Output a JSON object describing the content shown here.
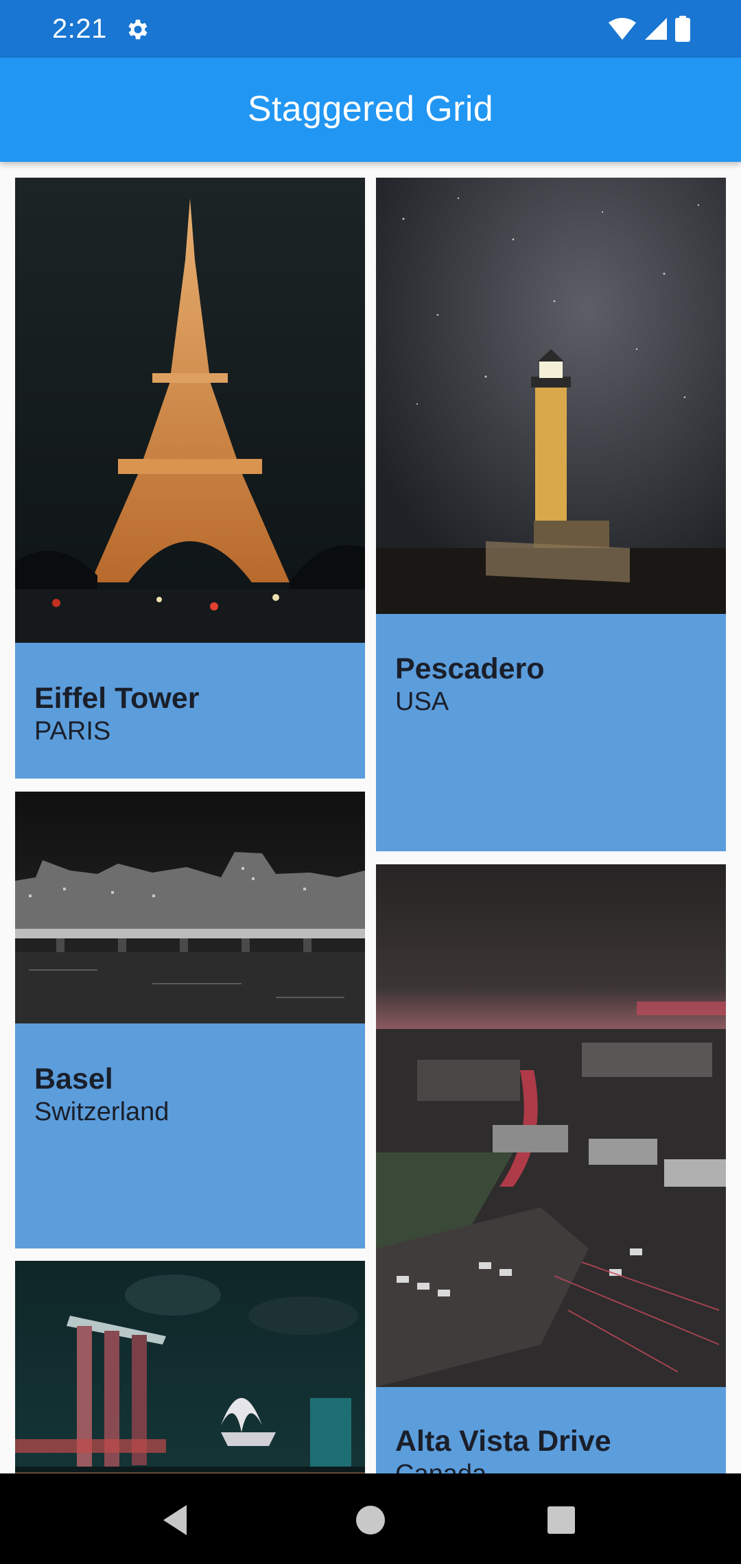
{
  "status_bar": {
    "time": "2:21",
    "icons": [
      "gear-icon",
      "wifi-icon",
      "cell-signal-icon",
      "battery-icon"
    ]
  },
  "app_bar": {
    "title": "Staggered Grid",
    "color": "#2196f3"
  },
  "cards": [
    {
      "title": "Eiffel Tower",
      "subtitle": "PARIS",
      "image": "eiffel-tower-photo"
    },
    {
      "title": "Pescadero",
      "subtitle": "USA",
      "image": "lighthouse-photo"
    },
    {
      "title": "Basel",
      "subtitle": "Switzerland",
      "image": "basel-bridge-photo"
    },
    {
      "title": "Alta Vista Drive",
      "subtitle": "Canada",
      "image": "city-aerial-photo"
    },
    {
      "title": "",
      "subtitle": "",
      "image": "singapore-marina-photo"
    }
  ],
  "colors": {
    "status_bar": "#1976d2",
    "card_background": "#5c9ddc",
    "text": "#1a1f2a"
  },
  "nav_bar": {
    "icons": [
      "back-icon",
      "home-icon",
      "recents-icon"
    ]
  }
}
